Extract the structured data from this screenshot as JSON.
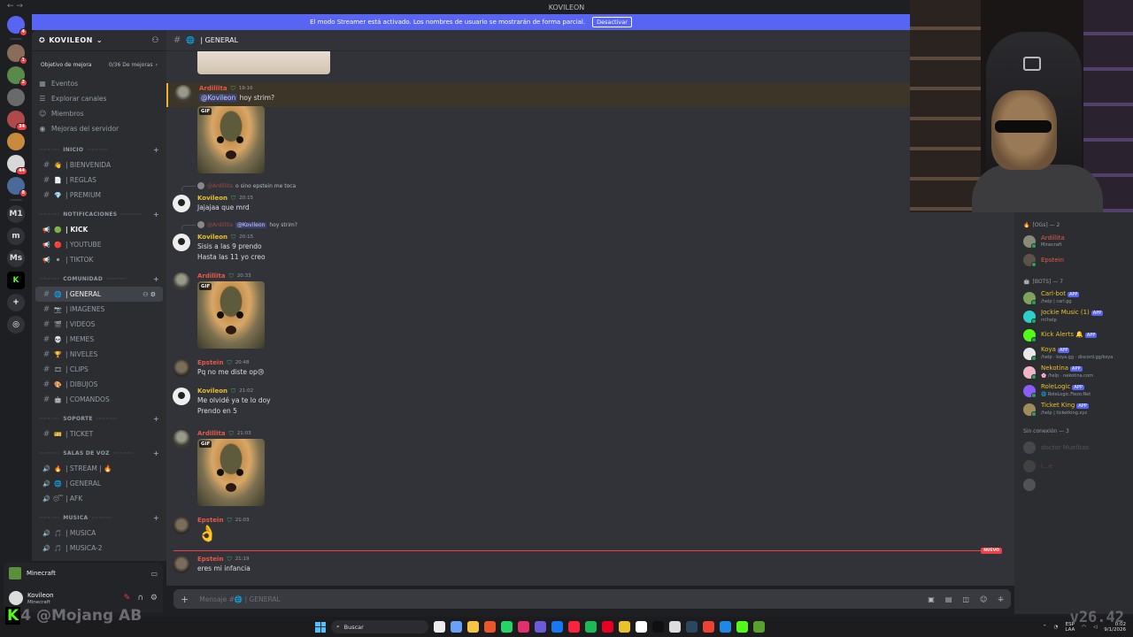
{
  "window": {
    "title": "KOVILEON",
    "back_glyph": "← →"
  },
  "banner": {
    "text": "El modo Streamer está activado. Los nombres de usuario se mostrarán de forma parcial.",
    "button": "Desactivar"
  },
  "server": {
    "name": "KOVILEON",
    "goal_label": "Objetivo de mejora",
    "goal_count": "0/36 De mejoras"
  },
  "nav": [
    {
      "icon": "calendar-icon",
      "glyph": "▦",
      "label": "Eventos"
    },
    {
      "icon": "browse-icon",
      "glyph": "☰",
      "label": "Explorar canales"
    },
    {
      "icon": "members-icon",
      "glyph": "☺",
      "label": "Miembros"
    },
    {
      "icon": "boost-icon",
      "glyph": "◉",
      "label": "Mejoras del servidor"
    }
  ],
  "categories": [
    {
      "name": "INICIO",
      "channels": [
        {
          "type": "text",
          "emoji": "👋",
          "label": "| BIENVENIDA"
        },
        {
          "type": "text",
          "emoji": "📄",
          "label": "| REGLAS"
        },
        {
          "type": "text",
          "emoji": "💎",
          "label": "| PREMIUM"
        }
      ]
    },
    {
      "name": "NOTIFICACIONES",
      "channels": [
        {
          "type": "announce",
          "emoji": "🟢",
          "label": "| KICK",
          "unread": true
        },
        {
          "type": "announce",
          "emoji": "🔴",
          "label": "| YOUTUBE"
        },
        {
          "type": "announce",
          "emoji": "⚫",
          "label": "| TIKTOK"
        }
      ]
    },
    {
      "name": "COMUNIDAD",
      "channels": [
        {
          "type": "text",
          "emoji": "🌐",
          "label": "| GENERAL",
          "active": true
        },
        {
          "type": "text",
          "emoji": "📷",
          "label": "| IMAGENES"
        },
        {
          "type": "text",
          "emoji": "🎬",
          "label": "| VIDEOS"
        },
        {
          "type": "text",
          "emoji": "💀",
          "label": "| MEMES"
        },
        {
          "type": "text",
          "emoji": "🏆",
          "label": "| NIVELES"
        },
        {
          "type": "text",
          "emoji": "🎞",
          "label": "| CLIPS"
        },
        {
          "type": "text",
          "emoji": "🎨",
          "label": "| DIBUJOS"
        },
        {
          "type": "text",
          "emoji": "🤖",
          "label": "| COMANDOS"
        }
      ]
    },
    {
      "name": "SOPORTE",
      "channels": [
        {
          "type": "text",
          "emoji": "🎫",
          "label": "| TICKET"
        }
      ]
    },
    {
      "name": "SALAS DE VOZ",
      "channels": [
        {
          "type": "voice",
          "emoji": "🔥",
          "label": "| STREAM | 🔥"
        },
        {
          "type": "voice",
          "emoji": "🌐",
          "label": "| GENERAL"
        },
        {
          "type": "voice",
          "emoji": "😴",
          "label": "| AFK"
        }
      ]
    },
    {
      "name": "MUSICA",
      "channels": [
        {
          "type": "voice",
          "emoji": "🎵",
          "label": "| MUSICA"
        },
        {
          "type": "voice",
          "emoji": "🎵",
          "label": "| MUSICA-2"
        }
      ]
    }
  ],
  "activity": {
    "label": "Minecraft"
  },
  "user": {
    "name": "Kovileon",
    "status": "Minecraft"
  },
  "channel_header": {
    "name": "| GENERAL"
  },
  "messages": [
    {
      "author": "Ardillita",
      "cls": "ard",
      "time": "19:16",
      "mention": "@Kovileon",
      "text": "hoy strim?",
      "highlight": true
    },
    {
      "author": "",
      "cls": "ard",
      "gif": true
    },
    {
      "reply_name": "@Ardillita",
      "reply_text": "o sino epstein me toca",
      "author": "Kovileon",
      "cls": "kov",
      "time": "20:15",
      "text": "Jajajaa que mrd"
    },
    {
      "reply_name": "@Ardillita",
      "reply_mention": "@Kovileon",
      "reply_text": "hoy strim?",
      "author": "Kovileon",
      "cls": "kov",
      "time": "20:15",
      "text": "Sisis a las 9 prendo",
      "text2": "Hasta las 11 yo creo"
    },
    {
      "author": "Ardillita",
      "cls": "ard",
      "time": "20:33",
      "gif": true
    },
    {
      "author": "Epstein",
      "cls": "eps",
      "time": "20:48",
      "text": "Pq no me diste op😢"
    },
    {
      "author": "Kovileon",
      "cls": "kov",
      "time": "21:02",
      "text": "Me olvidé ya te lo doy",
      "text2": "Prendo en 5"
    },
    {
      "author": "Ardillita",
      "cls": "ard",
      "time": "21:03",
      "gif": true
    },
    {
      "author": "Epstein",
      "cls": "eps",
      "time": "21:03",
      "big_emoji": "👌"
    },
    {
      "author": "Epstein",
      "cls": "eps",
      "time": "21:19",
      "text": "eres mi infancia"
    }
  ],
  "gif_tag": "GIF",
  "new_tag": "NUEVO",
  "composer": {
    "placeholder": "Mensaje #🌐 | GENERAL"
  },
  "members": {
    "groups": [
      {
        "title": "[OGs] — 2",
        "icon": "🔥",
        "items": [
          {
            "name": "Ardillita",
            "status": "Minecraft",
            "color": "#e45a4a",
            "avatar": "#8a8a78"
          },
          {
            "name": "Epstein",
            "status": "",
            "color": "#e45a4a",
            "avatar": "#5c5248"
          }
        ]
      },
      {
        "title": "[BOTS] — 7",
        "icon": "🤖",
        "items": [
          {
            "name": "Carl-bot",
            "app": "APP",
            "status": "/help | carl.gg",
            "color": "#e9c12b",
            "avatar": "#7fa35a"
          },
          {
            "name": "Jockie Music (1)",
            "app": "APP",
            "status": "m!help",
            "color": "#e9c12b",
            "avatar": "#2ad0c9"
          },
          {
            "name": "Kick Alerts 🔔",
            "app": "APP",
            "status": "",
            "color": "#e9c12b",
            "avatar": "#53fc18"
          },
          {
            "name": "Koya",
            "app": "APP",
            "status": "/help · koya.gg · discord.gg/koya",
            "color": "#e9c12b",
            "avatar": "#e8e8e8"
          },
          {
            "name": "Nekotina",
            "app": "APP",
            "status": "🌸 /help · nekotina.com",
            "color": "#e9c12b",
            "avatar": "#f0b6c8"
          },
          {
            "name": "RoleLogic",
            "app": "APP",
            "status": "🌐 RoleLogic.Fiezo.Net",
            "color": "#e9c12b",
            "avatar": "#8b5cf6"
          },
          {
            "name": "Ticket King",
            "app": "APP",
            "status": "/help | ticketking.xyz",
            "color": "#e9c12b",
            "avatar": "#a08b5c"
          }
        ]
      },
      {
        "title": "Sin conexión — 3",
        "icon": "",
        "offline": true,
        "items": [
          {
            "name": "doctor Muelitas",
            "status": "",
            "color": "#949ba4",
            "avatar": "#777"
          },
          {
            "name": "l...e",
            "status": "",
            "color": "#e45a4a",
            "avatar": "#666"
          },
          {
            "name": "",
            "status": "",
            "color": "#949ba4",
            "avatar": "#999"
          }
        ]
      }
    ]
  },
  "rail": [
    {
      "label": "",
      "kind": "discord",
      "badge": "4"
    },
    {
      "label": "",
      "kind": "img",
      "color": "#8a6c5a",
      "badge": "1"
    },
    {
      "label": "",
      "kind": "img",
      "color": "#5a8a4a",
      "badge": "2"
    },
    {
      "label": "",
      "kind": "img",
      "color": "#6a6a6a",
      "badge": ""
    },
    {
      "label": "",
      "kind": "img",
      "color": "#b04a4a",
      "badge": "34"
    },
    {
      "label": "",
      "kind": "img",
      "color": "#c88a3c",
      "badge": ""
    },
    {
      "label": "",
      "kind": "img",
      "color": "#d8d8d8",
      "badge": "44"
    },
    {
      "label": "",
      "kind": "img",
      "color": "#4a6a9a",
      "badge": "8"
    },
    {
      "label": "M1",
      "kind": "text",
      "badge": ""
    },
    {
      "label": "m",
      "kind": "text",
      "badge": ""
    },
    {
      "label": "Ms",
      "kind": "text",
      "badge": ""
    },
    {
      "label": "K",
      "kind": "kick",
      "badge": ""
    },
    {
      "label": "+",
      "kind": "add",
      "badge": ""
    },
    {
      "label": "◎",
      "kind": "add",
      "badge": ""
    }
  ],
  "overlay": {
    "watermark": "@Mojang AB",
    "kick_digit": "4",
    "version": "v26.42"
  },
  "taskbar": {
    "search": "Buscar",
    "apps": [
      "#ececec",
      "#6aa0f7",
      "#f6c342",
      "#e8562a",
      "#25d366",
      "#e1306c",
      "#6b5bd8",
      "#1877f2",
      "#fa243c",
      "#1db954",
      "#e60023",
      "#e9c12b",
      "#ffffff",
      "#101010",
      "#dddddd",
      "#2a475e",
      "#ea4335",
      "#1e88e5",
      "#53fc18",
      "#5aa02c"
    ],
    "lang": "ESP",
    "lang2": "LAA",
    "time": "0:02",
    "date": "9/1/2026"
  }
}
